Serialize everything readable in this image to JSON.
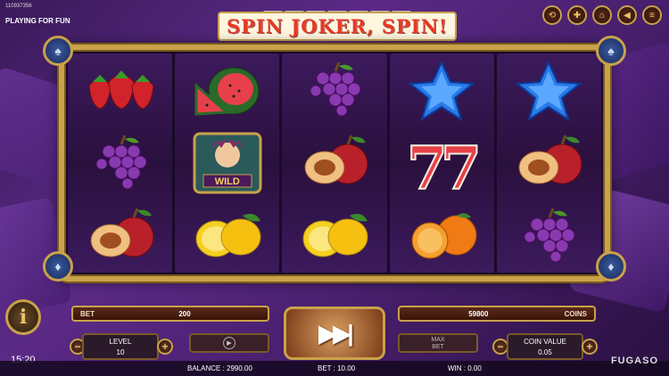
{
  "game": {
    "id": "110937356",
    "mode": "PLAYING FOR FUN",
    "logo": "SPIN JOKER, SPIN!",
    "provider": "FUGASO",
    "clock": "15:20"
  },
  "top_buttons": [
    "history-icon",
    "flag-uk-icon",
    "home-icon",
    "sound-icon",
    "menu-icon"
  ],
  "reels": [
    [
      "strawberry",
      "grapes",
      "plum"
    ],
    [
      "watermelon",
      "wild",
      "lemon"
    ],
    [
      "grapes",
      "plum",
      "lemon"
    ],
    [
      "star",
      "seven",
      "orange"
    ],
    [
      "star",
      "plum",
      "grapes"
    ]
  ],
  "wild_label": "WILD",
  "bet": {
    "label": "BET",
    "value": "200"
  },
  "coins": {
    "label": "COINS",
    "value": "59800"
  },
  "level": {
    "label": "LEVEL",
    "value": "10"
  },
  "coin_value": {
    "label": "COIN VALUE",
    "value": "0.05"
  },
  "max_bet": {
    "label1": "MAX",
    "label2": "BET"
  },
  "spin_symbol": "▶▶|",
  "status": {
    "balance": "BALANCE : 2990.00",
    "bet": "BET : 10.00",
    "win": "WIN : 0.00"
  },
  "colors": {
    "frame_gold": "#c9a24a",
    "background": "#5b2a86"
  }
}
